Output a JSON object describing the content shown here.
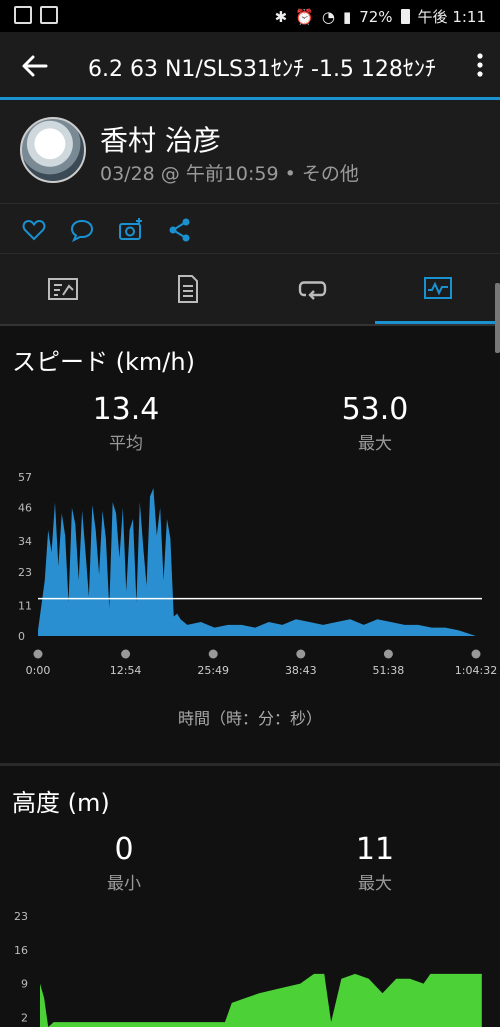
{
  "status_bar": {
    "battery": "72%",
    "time": "午後 1:11"
  },
  "app_bar": {
    "title": "6.2 63 N1/SLS31ｾﾝﾁ -1.5 128ｾﾝﾁ"
  },
  "header": {
    "name": "香村 治彦",
    "meta": "03/28 @ 午前10:59 • その他"
  },
  "tabs": [
    {
      "icon": "summary-icon",
      "active": false
    },
    {
      "icon": "details-icon",
      "active": false
    },
    {
      "icon": "laps-icon",
      "active": false
    },
    {
      "icon": "chart-icon",
      "active": true
    }
  ],
  "speed": {
    "title": "スピード (km/h)",
    "avg_value": "13.4",
    "avg_label": "平均",
    "max_value": "53.0",
    "max_label": "最大"
  },
  "elevation": {
    "title": "高度 (m)",
    "min_value": "0",
    "min_label": "最小",
    "max_value": "11",
    "max_label": "最大"
  },
  "colors": {
    "accent": "#1a91d1",
    "speed_fill": "#2a8fd0",
    "elev_fill": "#4cd137"
  },
  "chart_data": [
    {
      "type": "area",
      "ylabel": "",
      "xlabel": "時間（時：分：秒）",
      "yticks": [
        "0",
        "11",
        "23",
        "34",
        "46",
        "57"
      ],
      "ylim": [
        0,
        57
      ],
      "xticks": [
        "0:00",
        "12:54",
        "25:49",
        "38:43",
        "51:38",
        "1:04:32"
      ],
      "xlim": [
        0,
        64.53
      ],
      "avg_line": 13.4,
      "x_minutes": [
        0,
        1,
        1.5,
        2,
        2.5,
        3,
        3.5,
        4,
        4.5,
        5,
        5.5,
        6,
        6.5,
        7,
        7.5,
        8,
        8.5,
        9,
        9.5,
        10,
        10.5,
        11,
        11.5,
        12,
        12.5,
        13,
        13.5,
        14,
        14.5,
        15,
        15.5,
        16,
        16.5,
        17,
        17.5,
        18,
        18.5,
        19,
        19.5,
        20,
        20.5,
        21,
        22,
        24,
        26,
        28,
        30,
        32,
        34,
        36,
        38,
        40,
        42,
        44,
        46,
        48,
        50,
        52,
        54,
        56,
        58,
        60,
        62,
        64.5
      ],
      "values": [
        2,
        20,
        38,
        30,
        48,
        25,
        44,
        36,
        12,
        46,
        40,
        20,
        45,
        30,
        14,
        47,
        38,
        22,
        45,
        35,
        10,
        48,
        44,
        28,
        46,
        16,
        38,
        42,
        12,
        48,
        32,
        18,
        50,
        53,
        36,
        46,
        20,
        42,
        35,
        7,
        8,
        6,
        4,
        5,
        3,
        4,
        4,
        3,
        5,
        4,
        6,
        5,
        4,
        5,
        6,
        4,
        6,
        5,
        4,
        4,
        3,
        3,
        2,
        0
      ]
    },
    {
      "type": "area",
      "ylabel": "",
      "yticks": [
        "2",
        "9",
        "16",
        "23"
      ],
      "ylim": [
        0,
        23
      ],
      "x_minutes": [
        0,
        0.6,
        1.2,
        2,
        5,
        10,
        15,
        20,
        25,
        27,
        28,
        30,
        32,
        35,
        38,
        40,
        41.5,
        42.5,
        44,
        46,
        48,
        50,
        52,
        54,
        56,
        57,
        59,
        61,
        64.5
      ],
      "values": [
        9,
        6,
        0,
        1,
        1,
        1,
        1,
        1,
        1,
        1,
        5,
        6,
        7,
        8,
        9,
        11,
        11,
        1,
        10,
        11,
        10,
        7,
        10,
        10,
        9,
        11,
        11,
        11,
        11
      ]
    }
  ]
}
